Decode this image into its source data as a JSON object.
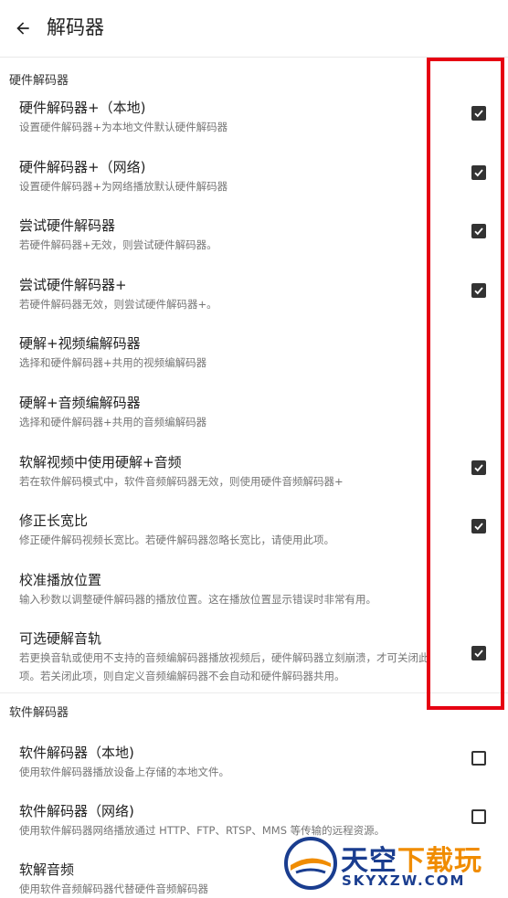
{
  "appbar": {
    "title": "解码器"
  },
  "hw_section": {
    "label": "硬件解码器"
  },
  "sw_section": {
    "label": "软件解码器"
  },
  "hw_items": [
    {
      "title": "硬件解码器+（本地)",
      "sub": "设置硬件解码器+为本地文件默认硬件解码器",
      "checked": true
    },
    {
      "title": "硬件解码器+（网络)",
      "sub": "设置硬件解码器+为网络播放默认硬件解码器",
      "checked": true
    },
    {
      "title": "尝试硬件解码器",
      "sub": "若硬件解码器+无效，则尝试硬件解码器。",
      "checked": true
    },
    {
      "title": "尝试硬件解码器+",
      "sub": "若硬件解码器无效，则尝试硬件解码器+。",
      "checked": true
    },
    {
      "title": "硬解+视频编解码器",
      "sub": "选择和硬件解码器+共用的视频编解码器",
      "checked": null
    },
    {
      "title": "硬解+音频编解码器",
      "sub": "选择和硬件解码器+共用的音频编解码器",
      "checked": null
    },
    {
      "title": "软解视频中使用硬解+音频",
      "sub": "若在软件解码模式中，软件音频解码器无效，则使用硬件音频解码器+",
      "checked": true
    },
    {
      "title": "修正长宽比",
      "sub": "修正硬件解码视频长宽比。若硬件解码器忽略长宽比，请使用此项。",
      "checked": true
    },
    {
      "title": "校准播放位置",
      "sub": "输入秒数以调整硬件解码器的播放位置。这在播放位置显示错误时非常有用。",
      "checked": null
    },
    {
      "title": "可选硬解音轨",
      "sub": "若更换音轨或使用不支持的音频编解码器播放视频后，硬件解码器立刻崩溃，才可关闭此项。若关闭此项，则自定义音频编解码器不会自动和硬件解码器共用。",
      "checked": true
    }
  ],
  "sw_items": [
    {
      "title": "软件解码器（本地)",
      "sub": "使用软件解码器播放设备上存储的本地文件。",
      "checked": false
    },
    {
      "title": "软件解码器（网络)",
      "sub": "使用软件解码器网络播放通过 HTTP、FTP、RTSP、MMS 等传输的远程资源。",
      "checked": false
    },
    {
      "title": "软解音频",
      "sub": "使用软件音频解码器代替硬件音频解码器",
      "checked": null
    }
  ],
  "watermark": {
    "text_a": "天空",
    "text_b": "下载玩",
    "sub": "SKYXZW.COM",
    "color_a": "#1a3d8f",
    "color_b": "#f08c00"
  },
  "colors": {
    "highlight": "#e60012",
    "checkbox": "#333333"
  }
}
